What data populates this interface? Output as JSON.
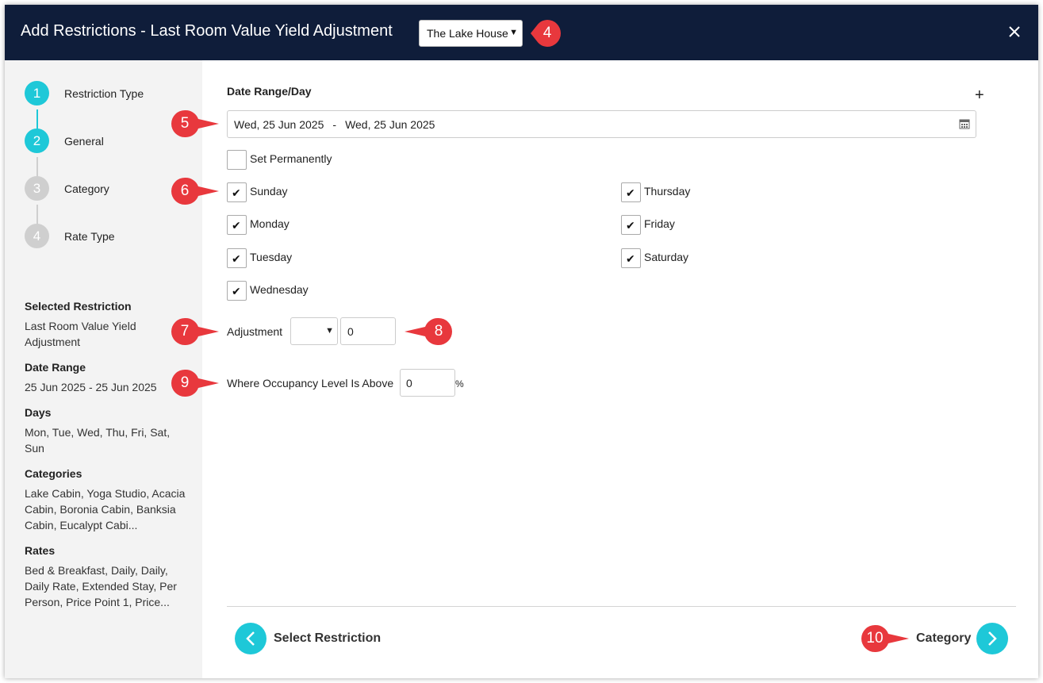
{
  "header": {
    "title": "Add Restrictions - Last Room Value Yield Adjustment",
    "property_selected": "The Lake House"
  },
  "sidebar": {
    "steps": [
      {
        "num": "1",
        "label": "Restriction Type",
        "state": "complete"
      },
      {
        "num": "2",
        "label": "General",
        "state": "current"
      },
      {
        "num": "3",
        "label": "Category",
        "state": "upcoming"
      },
      {
        "num": "4",
        "label": "Rate Type",
        "state": "upcoming"
      }
    ],
    "summary": {
      "restriction_heading": "Selected Restriction",
      "restriction_value": "Last Room Value Yield Adjustment",
      "date_heading": "Date Range",
      "date_value": "25 Jun 2025 - 25 Jun 2025",
      "days_heading": "Days",
      "days_value": "Mon, Tue, Wed, Thu, Fri, Sat, Sun",
      "categories_heading": "Categories",
      "categories_value": "Lake Cabin, Yoga Studio, Acacia Cabin, Boronia Cabin, Banksia Cabin, Eucalypt Cabi...",
      "rates_heading": "Rates",
      "rates_value": "Bed & Breakfast, Daily, Daily, Daily Rate, Extended Stay, Per Person, Price Point 1, Price..."
    }
  },
  "main": {
    "section_title": "Date Range/Day",
    "add_symbol": "+",
    "date_from": "Wed, 25 Jun 2025",
    "date_separator": "-",
    "date_to": "Wed, 25 Jun 2025",
    "set_permanently": {
      "label": "Set Permanently",
      "checked": false
    },
    "days": [
      {
        "label": "Sunday",
        "checked": true
      },
      {
        "label": "Monday",
        "checked": true
      },
      {
        "label": "Tuesday",
        "checked": true
      },
      {
        "label": "Wednesday",
        "checked": true
      },
      {
        "label": "Thursday",
        "checked": true
      },
      {
        "label": "Friday",
        "checked": true
      },
      {
        "label": "Saturday",
        "checked": true
      }
    ],
    "check_mark": "✔",
    "adjustment_label": "Adjustment",
    "adjustment_type": "",
    "adjustment_value": "0",
    "occupancy_label": "Where Occupancy Level Is Above",
    "occupancy_value": "0",
    "occupancy_unit": "%"
  },
  "footer": {
    "back_label": "Select Restriction",
    "next_label": "Category"
  },
  "callouts": [
    "4",
    "5",
    "6",
    "7",
    "8",
    "9",
    "10"
  ],
  "colors": {
    "header_bg": "#0f1d3a",
    "accent": "#1ec8d8",
    "callout_red": "#e8383d",
    "sidebar_bg": "#f3f3f3"
  }
}
